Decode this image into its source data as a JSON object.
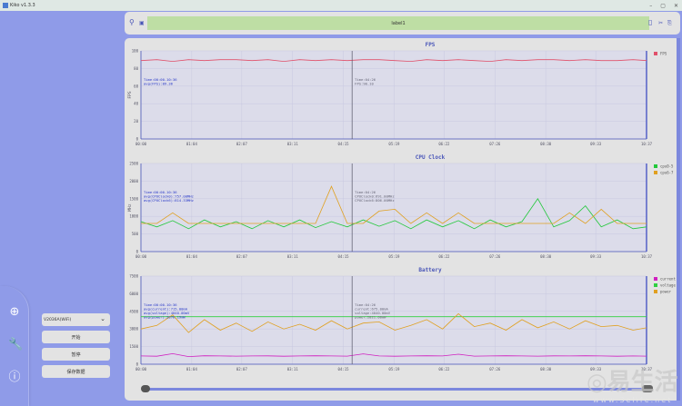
{
  "window": {
    "title": "Kiko v1.3.3",
    "minimize": "–",
    "maximize": "▢",
    "close": "✕"
  },
  "topbar": {
    "label": "label1",
    "icons": [
      "user-icon",
      "screen-icon",
      "save-icon",
      "cut-icon",
      "export-icon"
    ]
  },
  "sidebar": {
    "device_select": "V2036A(WiFi)",
    "start_label": "开始",
    "pause_label": "暂停",
    "save_label": "保存数据",
    "nav_icons": [
      "add-circle-icon",
      "wrench-icon",
      "info-icon"
    ]
  },
  "watermark": {
    "text": "易生活",
    "url": "www.3elife.net"
  },
  "colors": {
    "background": "#8f9be8",
    "plot_bg": "#dcdcea",
    "fps": "#e0506a",
    "cpu0_5": "#22c83a",
    "cpu6_7": "#e0a020",
    "current": "#d020c0",
    "voltage": "#30d040",
    "power": "#e0a020"
  },
  "chart_data": [
    {
      "type": "line",
      "title": "FPS",
      "ylabel": "FPS",
      "ylim": [
        0,
        100
      ],
      "yticks": [
        0,
        20,
        40,
        60,
        80,
        100
      ],
      "xticks": [
        "00:00",
        "01:04",
        "02:07",
        "03:11",
        "04:15",
        "05:19",
        "06:22",
        "07:26",
        "08:30",
        "09:33",
        "10:37"
      ],
      "x": [
        "00:00",
        "00:20",
        "00:40",
        "01:00",
        "01:20",
        "01:40",
        "02:00",
        "02:20",
        "02:40",
        "03:00",
        "03:20",
        "03:40",
        "04:00",
        "04:20",
        "04:40",
        "05:00",
        "05:20",
        "05:40",
        "06:00",
        "06:20",
        "06:40",
        "07:00",
        "07:20",
        "07:40",
        "08:00",
        "08:20",
        "08:40",
        "09:00",
        "09:20",
        "09:40",
        "10:00",
        "10:20",
        "10:37"
      ],
      "cursor": "04:26",
      "legend_position": "right",
      "grid": true,
      "series": [
        {
          "name": "FPS",
          "color": "#e0506a",
          "values": [
            89,
            90,
            88,
            90,
            89,
            90,
            90,
            89,
            90,
            88,
            90,
            89,
            90,
            89,
            90,
            90,
            89,
            88,
            90,
            89,
            90,
            89,
            88,
            90,
            89,
            90,
            90,
            89,
            90,
            89,
            89,
            90,
            89
          ]
        }
      ],
      "summary": [
        "Time:00:00-10:36",
        "avg(FPS):89.36"
      ],
      "cursor_text": [
        "Time:04:26",
        "FPS:90.10"
      ]
    },
    {
      "type": "line",
      "title": "CPU Clock",
      "ylabel": "MHz",
      "ylim": [
        0,
        2500
      ],
      "yticks": [
        0,
        500,
        1000,
        1500,
        2000,
        2500
      ],
      "xticks": [
        "00:00",
        "01:04",
        "02:07",
        "03:11",
        "04:15",
        "05:19",
        "06:22",
        "07:26",
        "08:30",
        "09:33",
        "10:37"
      ],
      "x": [
        "00:00",
        "00:20",
        "00:40",
        "01:00",
        "01:20",
        "01:40",
        "02:00",
        "02:20",
        "02:40",
        "03:00",
        "03:20",
        "03:40",
        "04:00",
        "04:20",
        "04:40",
        "05:00",
        "05:20",
        "05:40",
        "06:00",
        "06:20",
        "06:40",
        "07:00",
        "07:20",
        "07:40",
        "08:00",
        "08:20",
        "08:40",
        "09:00",
        "09:20",
        "09:40",
        "10:00",
        "10:20",
        "10:37"
      ],
      "cursor": "04:26",
      "legend_position": "right",
      "grid": true,
      "series": [
        {
          "name": "cpu0-5",
          "color": "#22c83a",
          "values": [
            850,
            700,
            880,
            650,
            900,
            700,
            850,
            650,
            880,
            700,
            900,
            680,
            850,
            700,
            900,
            720,
            880,
            650,
            900,
            700,
            880,
            650,
            900,
            700,
            850,
            1500,
            700,
            880,
            1300,
            700,
            900,
            650,
            700
          ]
        },
        {
          "name": "cpu6-7",
          "color": "#e0a020",
          "values": [
            800,
            800,
            1100,
            800,
            800,
            800,
            800,
            800,
            800,
            800,
            800,
            800,
            1850,
            800,
            800,
            1150,
            1200,
            800,
            1100,
            800,
            1100,
            800,
            800,
            800,
            800,
            800,
            800,
            1100,
            800,
            1200,
            800,
            800,
            800
          ]
        }
      ],
      "summary": [
        "Time:00:00-10:36",
        "avg(CPUClock0):757.00MHz",
        "avg(CPUClock6):814.33MHz"
      ],
      "cursor_text": [
        "Time:04:26",
        "CPUClock0:691.00MHz",
        "CPUClock6:806.00MHz"
      ]
    },
    {
      "type": "line",
      "title": "Battery",
      "ylabel": "",
      "ylim": [
        0,
        7500
      ],
      "yticks": [
        0,
        1500,
        3000,
        4500,
        6000,
        7500
      ],
      "xticks": [
        "00:00",
        "01:04",
        "02:07",
        "03:11",
        "04:15",
        "05:19",
        "06:22",
        "07:26",
        "08:30",
        "09:33",
        "10:37"
      ],
      "x": [
        "00:00",
        "00:20",
        "00:40",
        "01:00",
        "01:20",
        "01:40",
        "02:00",
        "02:20",
        "02:40",
        "03:00",
        "03:20",
        "03:40",
        "04:00",
        "04:20",
        "04:40",
        "05:00",
        "05:20",
        "05:40",
        "06:00",
        "06:20",
        "06:40",
        "07:00",
        "07:20",
        "07:40",
        "08:00",
        "08:20",
        "08:40",
        "09:00",
        "09:20",
        "09:40",
        "10:00",
        "10:20",
        "10:37"
      ],
      "cursor": "04:26",
      "legend_position": "right",
      "grid": true,
      "series": [
        {
          "name": "current",
          "color": "#d020c0",
          "values": [
            700,
            680,
            900,
            650,
            720,
            700,
            690,
            700,
            710,
            680,
            700,
            720,
            700,
            690,
            880,
            700,
            680,
            700,
            720,
            700,
            850,
            690,
            700,
            720,
            700,
            690,
            710,
            700,
            720,
            700,
            680,
            700,
            690
          ]
        },
        {
          "name": "voltage",
          "color": "#30d040",
          "values": [
            4040,
            4040,
            4040,
            4040,
            4040,
            4040,
            4040,
            4040,
            4040,
            4040,
            4040,
            4040,
            4040,
            4040,
            4040,
            4040,
            4040,
            4040,
            4040,
            4040,
            4040,
            4040,
            4040,
            4040,
            4040,
            4040,
            4040,
            4040,
            4040,
            4040,
            4040,
            4040,
            4040
          ]
        },
        {
          "name": "power",
          "color": "#e0a020",
          "values": [
            3000,
            3300,
            4200,
            2700,
            3800,
            2900,
            3500,
            2800,
            3600,
            3000,
            3400,
            2900,
            3700,
            3000,
            3500,
            3600,
            2900,
            3300,
            3800,
            3000,
            4300,
            3200,
            3500,
            2900,
            3800,
            3100,
            3600,
            3000,
            3700,
            3200,
            3300,
            2900,
            3100
          ]
        }
      ],
      "summary": [
        "Time:00:00-10:36",
        "avg(current):715.00mA",
        "avg(voltage):4040.00mV",
        "avg(power):2876.19mW"
      ],
      "cursor_text": [
        "Time:04:26",
        "current:675.00mA",
        "voltage:4040.00mV",
        "power:2821.00mW"
      ]
    }
  ]
}
